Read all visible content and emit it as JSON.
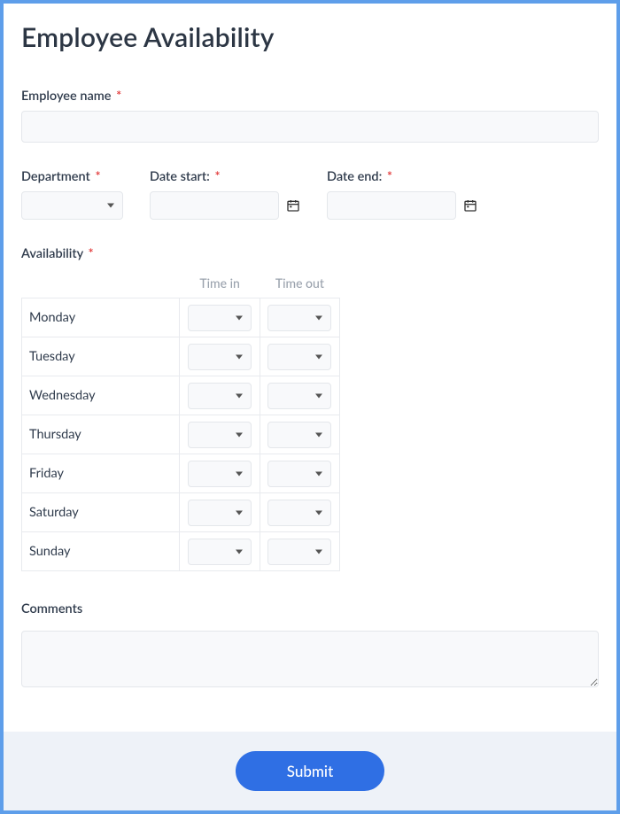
{
  "title": "Employee Availability",
  "fields": {
    "employee_name": {
      "label": "Employee name",
      "value": ""
    },
    "department": {
      "label": "Department",
      "value": ""
    },
    "date_start": {
      "label": "Date start:",
      "value": ""
    },
    "date_end": {
      "label": "Date end:",
      "value": ""
    },
    "availability": {
      "label": "Availability"
    },
    "comments": {
      "label": "Comments",
      "value": ""
    }
  },
  "availability_table": {
    "headers": {
      "time_in": "Time in",
      "time_out": "Time out"
    },
    "days": [
      {
        "name": "Monday",
        "time_in": "",
        "time_out": ""
      },
      {
        "name": "Tuesday",
        "time_in": "",
        "time_out": ""
      },
      {
        "name": "Wednesday",
        "time_in": "",
        "time_out": ""
      },
      {
        "name": "Thursday",
        "time_in": "",
        "time_out": ""
      },
      {
        "name": "Friday",
        "time_in": "",
        "time_out": ""
      },
      {
        "name": "Saturday",
        "time_in": "",
        "time_out": ""
      },
      {
        "name": "Sunday",
        "time_in": "",
        "time_out": ""
      }
    ]
  },
  "required_marker": "*",
  "submit_label": "Submit"
}
